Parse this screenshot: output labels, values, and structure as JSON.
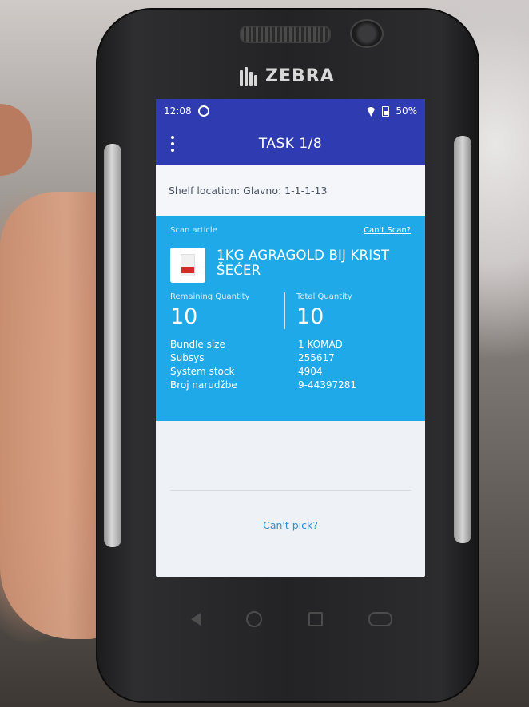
{
  "device": {
    "brand": "ZEBRA"
  },
  "status_bar": {
    "time": "12:08",
    "battery": "50%"
  },
  "app_bar": {
    "title": "TASK 1/8"
  },
  "shelf": {
    "label": "Shelf location: Glavno: 1-1-1-13"
  },
  "article": {
    "scan_label": "Scan article",
    "cant_scan_label": "Can't Scan?",
    "name_line1": "1KG AGRAGOLD BIJ KRIST",
    "name_line2": "ŠEĆER",
    "remaining_label": "Remaining Quantity",
    "remaining_value": "10",
    "total_label": "Total Quantity",
    "total_value": "10",
    "details": [
      {
        "label": "Bundle size",
        "value": "1 KOMAD"
      },
      {
        "label": "Subsys",
        "value": "255617"
      },
      {
        "label": "System stock",
        "value": "4904"
      },
      {
        "label": "Broj narudžbe",
        "value": "9-44397281"
      }
    ]
  },
  "footer": {
    "cant_pick_label": "Can't pick?"
  },
  "colors": {
    "app_bar": "#2f3bb0",
    "card": "#1fa9e8",
    "link": "#2b8fd0"
  }
}
